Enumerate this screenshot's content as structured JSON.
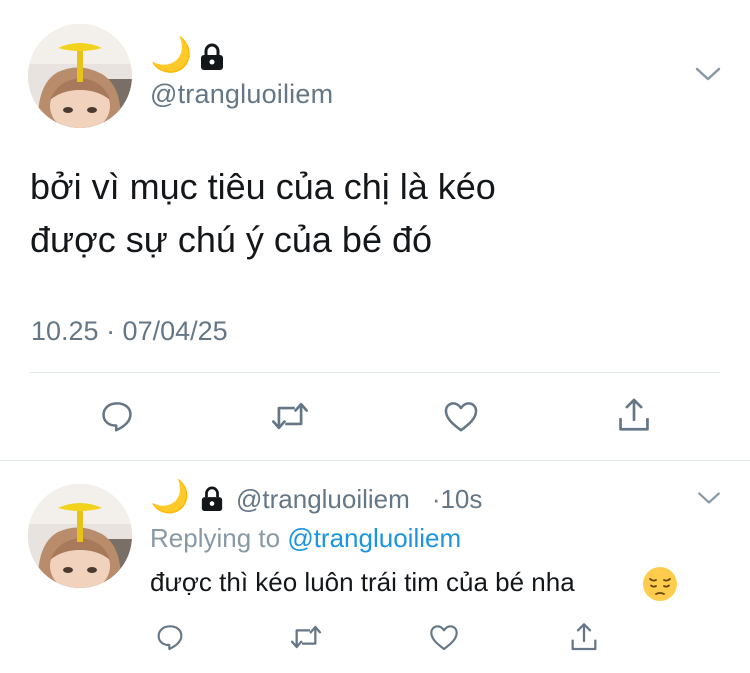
{
  "tweet": {
    "handle": "@trangluoiliem",
    "name_emoji": "🌙",
    "text_line_1": "bởi vì mục tiêu của chị là kéo",
    "text_line_2": "được sự chú ý của bé đó",
    "timestamp": "10.25 · 07/04/25"
  },
  "reply": {
    "handle": "@trangluoiliem",
    "name_emoji": "🌙",
    "time": "·10s",
    "replying_prefix": "Replying to",
    "replying_mention": "@trangluoiliem",
    "text": "được thì kéo luôn trái tim của bé nha",
    "emoji": "pensive-face"
  },
  "actions": [
    "reply-icon",
    "retweet-icon",
    "like-icon",
    "share-icon"
  ],
  "colors": {
    "text": "#14171a",
    "secondary": "#657786",
    "link": "#1b95e0",
    "divider": "#e1e8ed",
    "moon": "#f5c518"
  }
}
